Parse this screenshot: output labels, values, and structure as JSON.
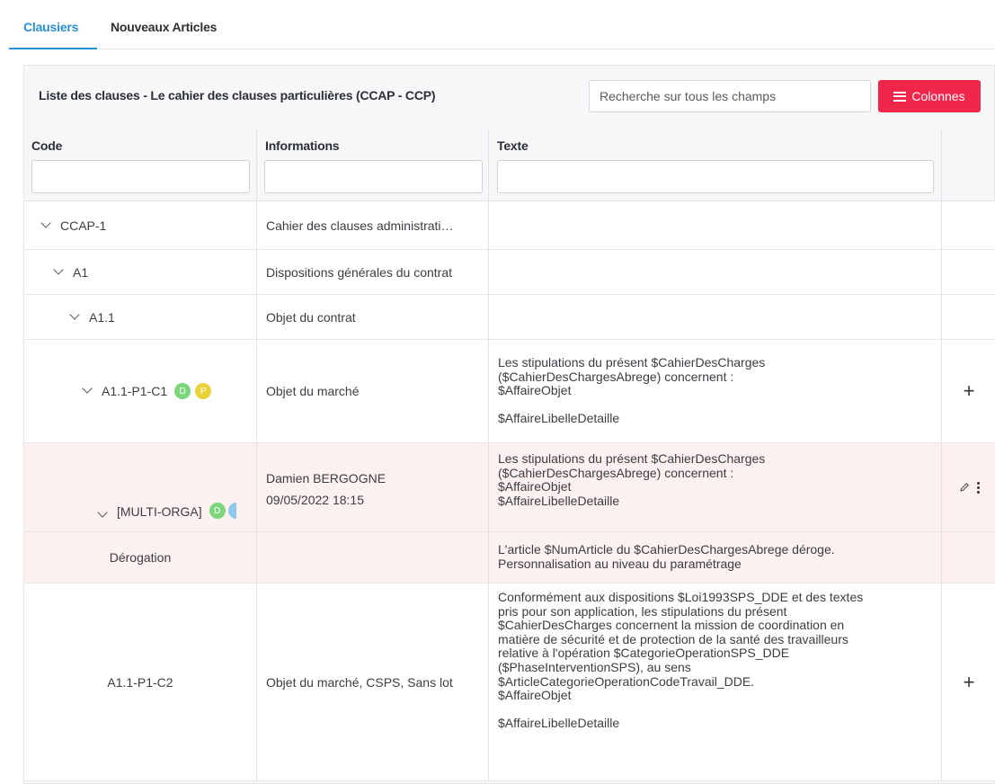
{
  "tabs": [
    {
      "label": "Clausiers",
      "active": true
    },
    {
      "label": "Nouveaux Articles",
      "active": false
    }
  ],
  "panel": {
    "title": "Liste des clauses - Le cahier des clauses particulières (CCAP - CCP)",
    "search_placeholder": "Recherche sur tous les champs",
    "columns_button": "Colonnes"
  },
  "columns": {
    "code": "Code",
    "informations": "Informations",
    "texte": "Texte"
  },
  "rows": [
    {
      "code": "CCAP-1",
      "info": "Cahier des clauses administrati…",
      "text": ""
    },
    {
      "code": "A1",
      "info": "Dispositions générales du contrat",
      "text": ""
    },
    {
      "code": "A1.1",
      "info": "Objet du contrat",
      "text": ""
    },
    {
      "code": "A1.1-P1-C1",
      "badges": [
        "D",
        "P"
      ],
      "info": "Objet du marché",
      "text": "Les stipulations du présent $CahierDesCharges\n($CahierDesChargesAbrege) concernent :\n$AffaireObjet\n\n$AffaireLibelleDetaille",
      "action": "+"
    },
    {
      "code": "[MULTI-ORGA]",
      "badges": [
        "D"
      ],
      "info_author": "Damien BERGOGNE",
      "info_date": "09/05/2022 18:15",
      "text": "Les stipulations du présent $CahierDesCharges\n($CahierDesChargesAbrege) concernent :\n$AffaireObjet\n$AffaireLibelleDetaille"
    },
    {
      "code": "Dérogation",
      "info": "",
      "text": "L'article $NumArticle du $CahierDesChargesAbrege déroge.\nPersonnalisation au niveau du paramétrage"
    },
    {
      "code": "A1.1-P1-C2",
      "info": "Objet du marché, CSPS, Sans lot",
      "text": "Conformément aux dispositions $Loi1993SPS_DDE et des textes\npris pour son application, les stipulations du présent\n$CahierDesCharges concernent la mission de coordination en\nmatière de sécurité et de protection de la santé des travailleurs\nrelative à l'opération $CategorieOperationSPS_DDE\n($PhaseInterventionSPS), au sens\n$ArticleCategorieOperationCodeTravail_DDE.\n$AffaireObjet\n\n$AffaireLibelleDetaille",
      "action": "+"
    }
  ],
  "colors": {
    "accent": "#2a8fd4",
    "danger": "#f0274a",
    "highlight_row": "#fdf0f0"
  },
  "icons": [
    "chevron-down-icon",
    "plus-icon",
    "pencil-icon",
    "kebab-menu-icon",
    "menu-lines-icon"
  ]
}
